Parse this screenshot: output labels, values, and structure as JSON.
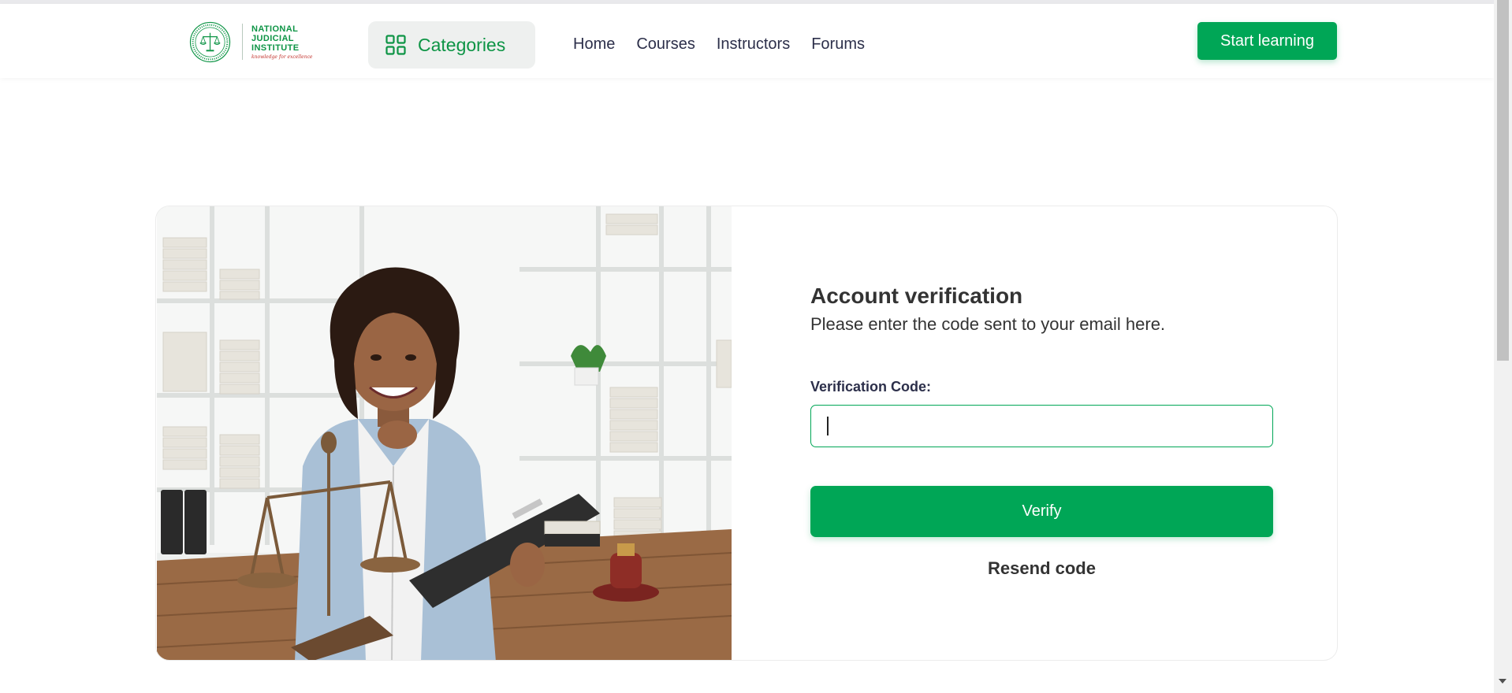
{
  "header": {
    "logo": {
      "line1": "NATIONAL",
      "line2": "JUDICIAL",
      "line3": "INSTITUTE",
      "tagline": "knowledge for excellence"
    },
    "categories_label": "Categories",
    "nav": [
      "Home",
      "Courses",
      "Instructors",
      "Forums"
    ],
    "cta_label": "Start learning"
  },
  "verification": {
    "title": "Account verification",
    "subtitle": "Please enter the code sent to your email here.",
    "field_label": "Verification Code:",
    "field_value": "",
    "submit_label": "Verify",
    "resend_label": "Resend code"
  },
  "colors": {
    "brand_green": "#00a656",
    "logo_green": "#0d9445",
    "tagline_red": "#c2302a",
    "nav_text": "#2c2f4a"
  },
  "icons": [
    "grid-icon",
    "seal-icon",
    "caret-down-icon"
  ]
}
